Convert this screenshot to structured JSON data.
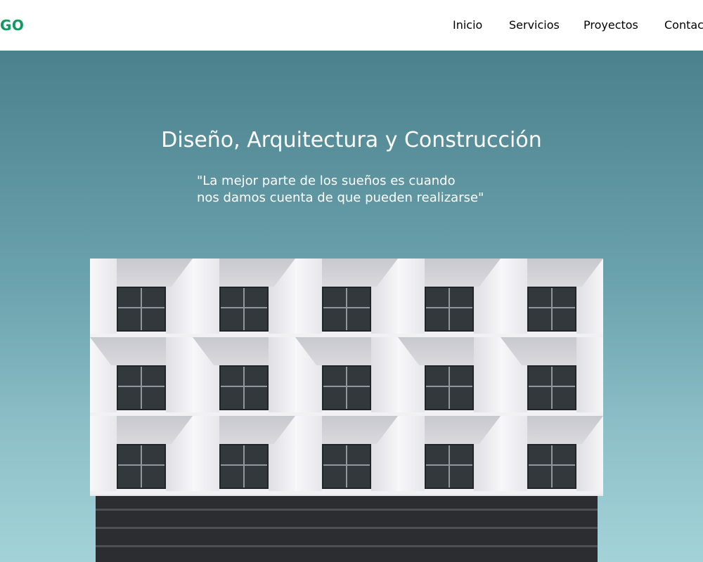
{
  "nav": {
    "logo": "GO",
    "items": [
      {
        "label": "Inicio"
      },
      {
        "label": "Servicios"
      },
      {
        "label": "Proyectos"
      },
      {
        "label": "Contac"
      }
    ]
  },
  "hero": {
    "title": "Diseño, Arquitectura y Construcción",
    "quote": "\"La mejor parte de los sueños es cuando\nnos damos cuenta de que pueden realizarse\""
  },
  "colors": {
    "accent": "#16966b",
    "hero_top": "#4b818d",
    "hero_bottom": "#a3d3d9"
  }
}
